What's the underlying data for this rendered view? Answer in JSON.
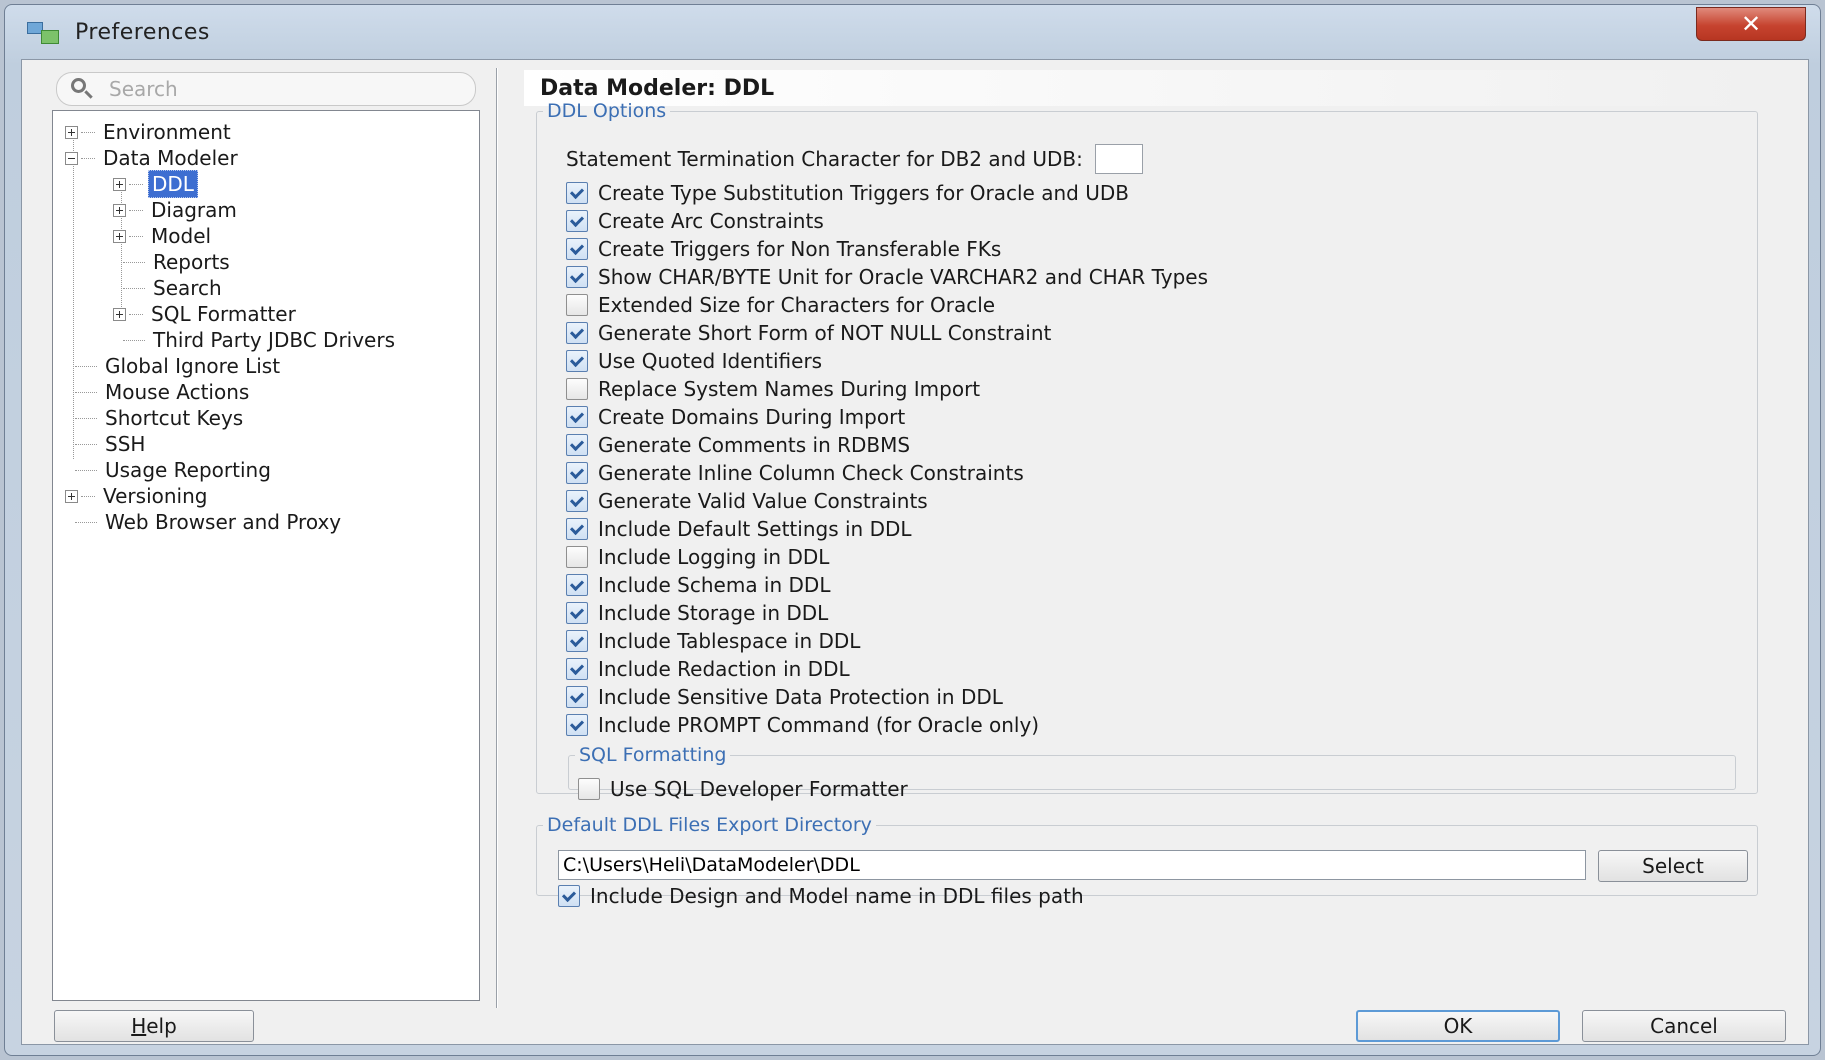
{
  "window": {
    "title": "Preferences",
    "close_label": "✕"
  },
  "search": {
    "placeholder": "Search"
  },
  "tree": {
    "items": [
      {
        "label": "Environment"
      },
      {
        "label": "Data Modeler"
      },
      {
        "label": "DDL"
      },
      {
        "label": "Diagram"
      },
      {
        "label": "Model"
      },
      {
        "label": "Reports"
      },
      {
        "label": "Search"
      },
      {
        "label": "SQL Formatter"
      },
      {
        "label": "Third Party JDBC Drivers"
      },
      {
        "label": "Global Ignore List"
      },
      {
        "label": "Mouse Actions"
      },
      {
        "label": "Shortcut Keys"
      },
      {
        "label": "SSH"
      },
      {
        "label": "Usage Reporting"
      },
      {
        "label": "Versioning"
      },
      {
        "label": "Web Browser and Proxy"
      }
    ],
    "selected": "DDL"
  },
  "page": {
    "title": "Data Modeler: DDL"
  },
  "ddl_options": {
    "legend": "DDL Options",
    "termination_label": "Statement Termination Character for DB2 and UDB:",
    "termination_value": "",
    "options": [
      {
        "label": "Create Type Substitution Triggers for Oracle and UDB",
        "checked": true
      },
      {
        "label": "Create Arc Constraints",
        "checked": true
      },
      {
        "label": "Create Triggers for Non Transferable FKs",
        "checked": true
      },
      {
        "label": "Show CHAR/BYTE Unit for Oracle VARCHAR2 and CHAR Types",
        "checked": true
      },
      {
        "label": "Extended Size for Characters for Oracle",
        "checked": false
      },
      {
        "label": "Generate Short Form of NOT NULL Constraint",
        "checked": true
      },
      {
        "label": "Use Quoted Identifiers",
        "checked": true
      },
      {
        "label": "Replace System Names During Import",
        "checked": false
      },
      {
        "label": "Create Domains During Import",
        "checked": true
      },
      {
        "label": "Generate Comments in RDBMS",
        "checked": true
      },
      {
        "label": "Generate Inline Column Check Constraints",
        "checked": true
      },
      {
        "label": "Generate Valid Value Constraints",
        "checked": true
      },
      {
        "label": "Include Default Settings in DDL",
        "checked": true
      },
      {
        "label": "Include Logging in DDL",
        "checked": false
      },
      {
        "label": "Include Schema in DDL",
        "checked": true
      },
      {
        "label": "Include Storage in DDL",
        "checked": true
      },
      {
        "label": "Include Tablespace in DDL",
        "checked": true
      },
      {
        "label": "Include Redaction in DDL",
        "checked": true
      },
      {
        "label": "Include Sensitive Data Protection in DDL",
        "checked": true
      },
      {
        "label": "Include PROMPT Command (for Oracle only)",
        "checked": true
      }
    ]
  },
  "sql_formatting": {
    "legend": "SQL Formatting",
    "option": {
      "label": "Use SQL Developer Formatter",
      "checked": false
    }
  },
  "export_dir": {
    "legend": "Default DDL Files Export Directory",
    "path": "C:\\Users\\Heli\\DataModeler\\DDL",
    "select_label": "Select",
    "include_option": {
      "label": "Include Design and Model name in DDL files path",
      "checked": true
    }
  },
  "buttons": {
    "help_mnemonic": "H",
    "help_rest": "elp",
    "ok": "OK",
    "cancel": "Cancel"
  }
}
